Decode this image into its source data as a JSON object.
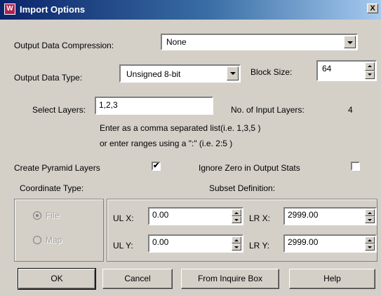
{
  "window": {
    "title": "Import Options",
    "close_label": "X",
    "icon_glyph": "W"
  },
  "compression": {
    "label": "Output Data Compression:",
    "value": "None"
  },
  "data_type": {
    "label": "Output Data Type:",
    "value": "Unsigned 8-bit"
  },
  "block_size": {
    "label": "Block Size:",
    "value": "64"
  },
  "layers": {
    "label": "Select Layers:",
    "value": "1,2,3",
    "count_label": "No. of Input Layers:",
    "count_value": "4",
    "hint1": "Enter as a comma separated list(i.e. 1,3,5 )",
    "hint2": "or enter ranges using a \":\" (i.e. 2:5 )"
  },
  "pyramid": {
    "label": "Create Pyramid Layers",
    "checked": true,
    "check_glyph": "✔"
  },
  "ignore_zero": {
    "label": "Ignore Zero in Output Stats",
    "checked": false
  },
  "coordinate": {
    "label": "Coordinate Type:",
    "options": [
      "File",
      "Map"
    ],
    "selected": "File"
  },
  "subset": {
    "label": "Subset Definition:",
    "ulx_label": "UL X:",
    "ulx_value": "0.00",
    "uly_label": "UL Y:",
    "uly_value": "0.00",
    "lrx_label": "LR X:",
    "lrx_value": "2999.00",
    "lry_label": "LR Y:",
    "lry_value": "2999.00"
  },
  "buttons": {
    "ok": "OK",
    "cancel": "Cancel",
    "inquire": "From Inquire Box",
    "help": "Help"
  }
}
